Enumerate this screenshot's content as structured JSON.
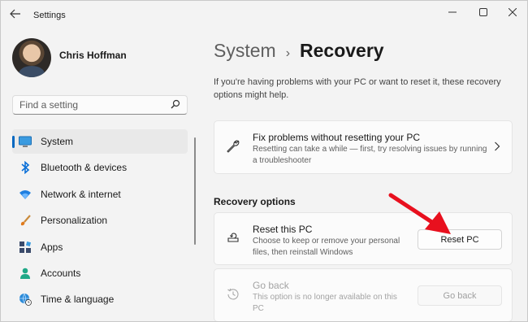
{
  "window": {
    "title": "Settings",
    "back_icon": "arrow-left-icon",
    "min_label": "–",
    "max_label": "☐",
    "close_label": "✕"
  },
  "user": {
    "name": "Chris Hoffman"
  },
  "search": {
    "placeholder": "Find a setting",
    "icon": "search-icon"
  },
  "sidebar": {
    "items": [
      {
        "label": "System",
        "icon": "monitor-icon",
        "active": true
      },
      {
        "label": "Bluetooth & devices",
        "icon": "bluetooth-icon"
      },
      {
        "label": "Network & internet",
        "icon": "wifi-icon"
      },
      {
        "label": "Personalization",
        "icon": "paintbrush-icon"
      },
      {
        "label": "Apps",
        "icon": "apps-icon"
      },
      {
        "label": "Accounts",
        "icon": "person-icon"
      },
      {
        "label": "Time & language",
        "icon": "globe-clock-icon"
      }
    ]
  },
  "breadcrumb": {
    "parent": "System",
    "separator": "›",
    "current": "Recovery"
  },
  "intro": "If you're having problems with your PC or want to reset it, these recovery options might help.",
  "fix_card": {
    "title": "Fix problems without resetting your PC",
    "desc": "Resetting can take a while — first, try resolving issues by running a troubleshooter",
    "icon": "wrench-icon"
  },
  "recovery": {
    "section_title": "Recovery options",
    "reset": {
      "title": "Reset this PC",
      "desc": "Choose to keep or remove your personal files, then reinstall Windows",
      "button": "Reset PC",
      "icon": "reset-pc-icon"
    },
    "goback": {
      "title": "Go back",
      "desc": "This option is no longer available on this PC",
      "button": "Go back",
      "icon": "history-icon"
    }
  },
  "colors": {
    "accent": "#0067c0",
    "annotation_arrow": "#e8101e"
  }
}
